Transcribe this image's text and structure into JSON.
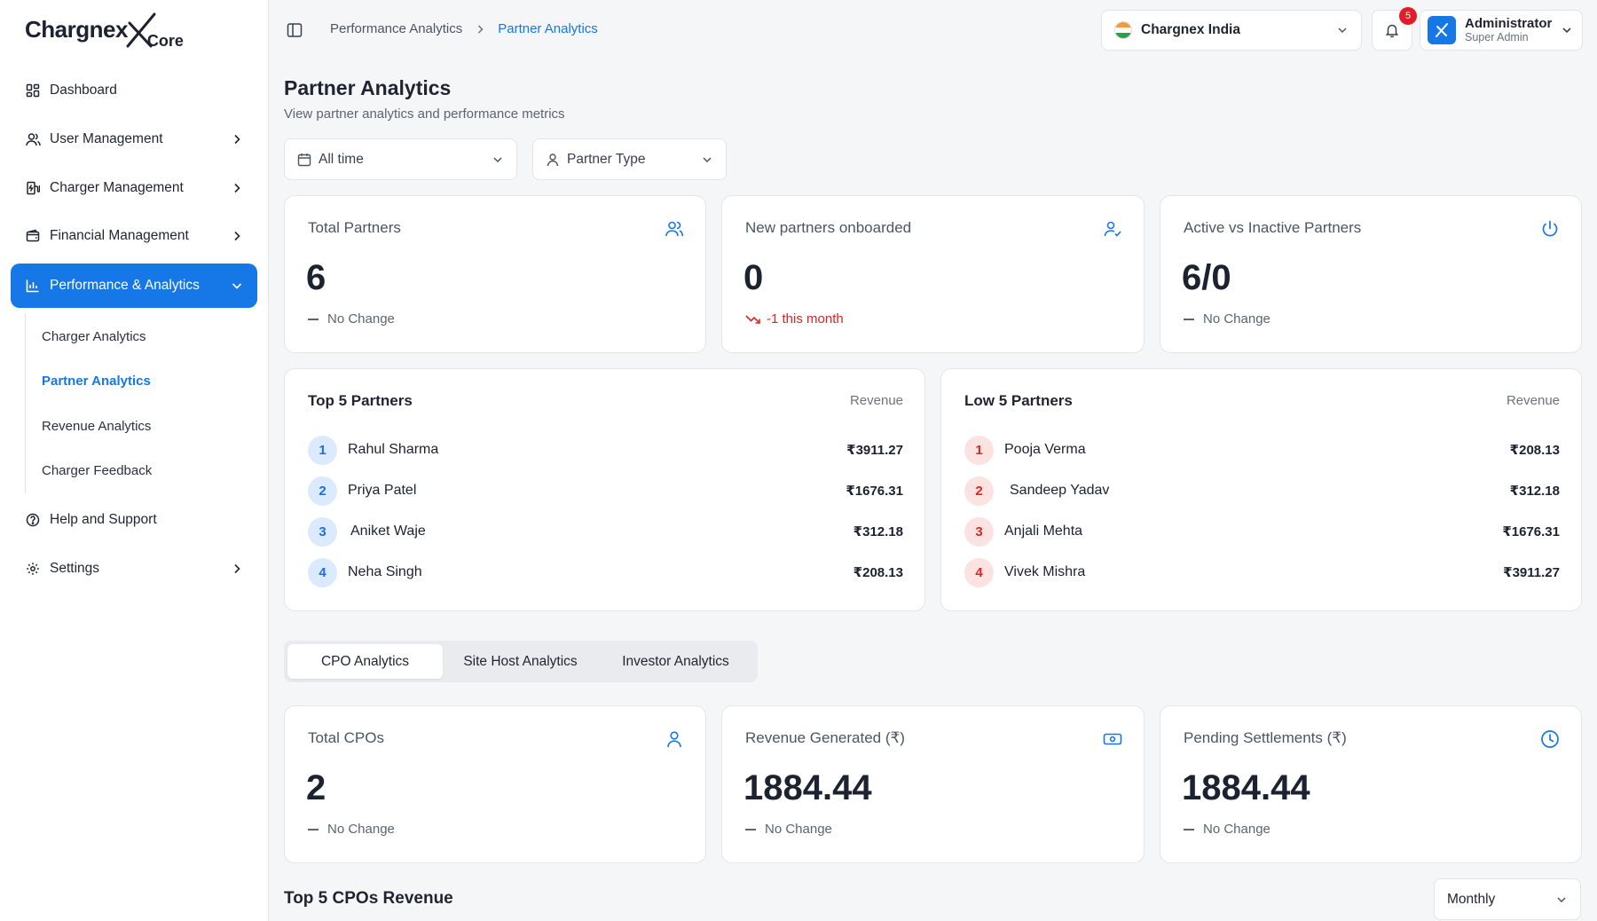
{
  "brand": {
    "name": "Chargnex",
    "suffix": "Core"
  },
  "sidebar": {
    "items": [
      {
        "label": "Dashboard",
        "icon": "grid-icon",
        "has_chevron": false
      },
      {
        "label": "User Management",
        "icon": "users-icon",
        "has_chevron": true
      },
      {
        "label": "Charger Management",
        "icon": "charger-icon",
        "has_chevron": true
      },
      {
        "label": "Financial Management",
        "icon": "wallet-icon",
        "has_chevron": true
      },
      {
        "label": "Performance & Analytics",
        "icon": "bar-chart-icon",
        "has_chevron": true,
        "active": true
      },
      {
        "label": "Help and Support",
        "icon": "help-icon",
        "has_chevron": false
      },
      {
        "label": "Settings",
        "icon": "gear-icon",
        "has_chevron": true
      }
    ],
    "subitems": [
      {
        "label": "Charger Analytics"
      },
      {
        "label": "Partner Analytics",
        "active": true
      },
      {
        "label": "Revenue Analytics"
      },
      {
        "label": "Charger Feedback"
      }
    ]
  },
  "header": {
    "breadcrumb": [
      "Performance Analytics",
      "Partner Analytics"
    ],
    "country": "Chargnex India",
    "notifications_count": "5",
    "user_name": "Administrator",
    "user_role": "Super Admin"
  },
  "page": {
    "title": "Partner Analytics",
    "subtitle": "View partner analytics and performance metrics"
  },
  "filters": {
    "time_range": "All time",
    "partner_type": "Partner Type"
  },
  "stats": [
    {
      "title": "Total Partners",
      "value": "6",
      "change": "No Change",
      "trend": "neutral",
      "icon": "users-icon"
    },
    {
      "title": "New partners onboarded",
      "value": "0",
      "change": "-1 this month",
      "trend": "down",
      "icon": "user-check-icon"
    },
    {
      "title": "Active vs Inactive Partners",
      "value": "6/0",
      "change": "No Change",
      "trend": "neutral",
      "icon": "power-icon"
    }
  ],
  "top_partners": {
    "title": "Top 5 Partners",
    "column": "Revenue",
    "rows": [
      {
        "rank": "1",
        "name": "Rahul Sharma",
        "revenue": "₹3911.27"
      },
      {
        "rank": "2",
        "name": "Priya Patel",
        "revenue": "₹1676.31"
      },
      {
        "rank": "3",
        "name": "Aniket Waje",
        "revenue": "₹312.18"
      },
      {
        "rank": "4",
        "name": "Neha Singh",
        "revenue": "₹208.13"
      }
    ]
  },
  "low_partners": {
    "title": "Low 5 Partners",
    "column": "Revenue",
    "rows": [
      {
        "rank": "1",
        "name": "Pooja Verma",
        "revenue": "₹208.13"
      },
      {
        "rank": "2",
        "name": "Sandeep Yadav",
        "revenue": "₹312.18"
      },
      {
        "rank": "3",
        "name": "Anjali Mehta",
        "revenue": "₹1676.31"
      },
      {
        "rank": "4",
        "name": "Vivek Mishra",
        "revenue": "₹3911.27"
      }
    ]
  },
  "tabs": [
    {
      "label": "CPO Analytics",
      "active": true
    },
    {
      "label": "Site Host Analytics"
    },
    {
      "label": "Investor Analytics"
    }
  ],
  "cpo_stats": [
    {
      "title": "Total CPOs",
      "value": "2",
      "change": "No Change",
      "icon": "user-icon"
    },
    {
      "title": "Revenue Generated (₹)",
      "value": "1884.44",
      "change": "No Change",
      "icon": "cash-icon"
    },
    {
      "title": "Pending Settlements (₹)",
      "value": "1884.44",
      "change": "No Change",
      "icon": "clock-icon"
    }
  ],
  "top_cpos": {
    "title": "Top 5 CPOs Revenue",
    "period": "Monthly"
  },
  "colors": {
    "accent": "#1677e6",
    "negative": "#dc2626",
    "badge": "#e11d2a"
  }
}
